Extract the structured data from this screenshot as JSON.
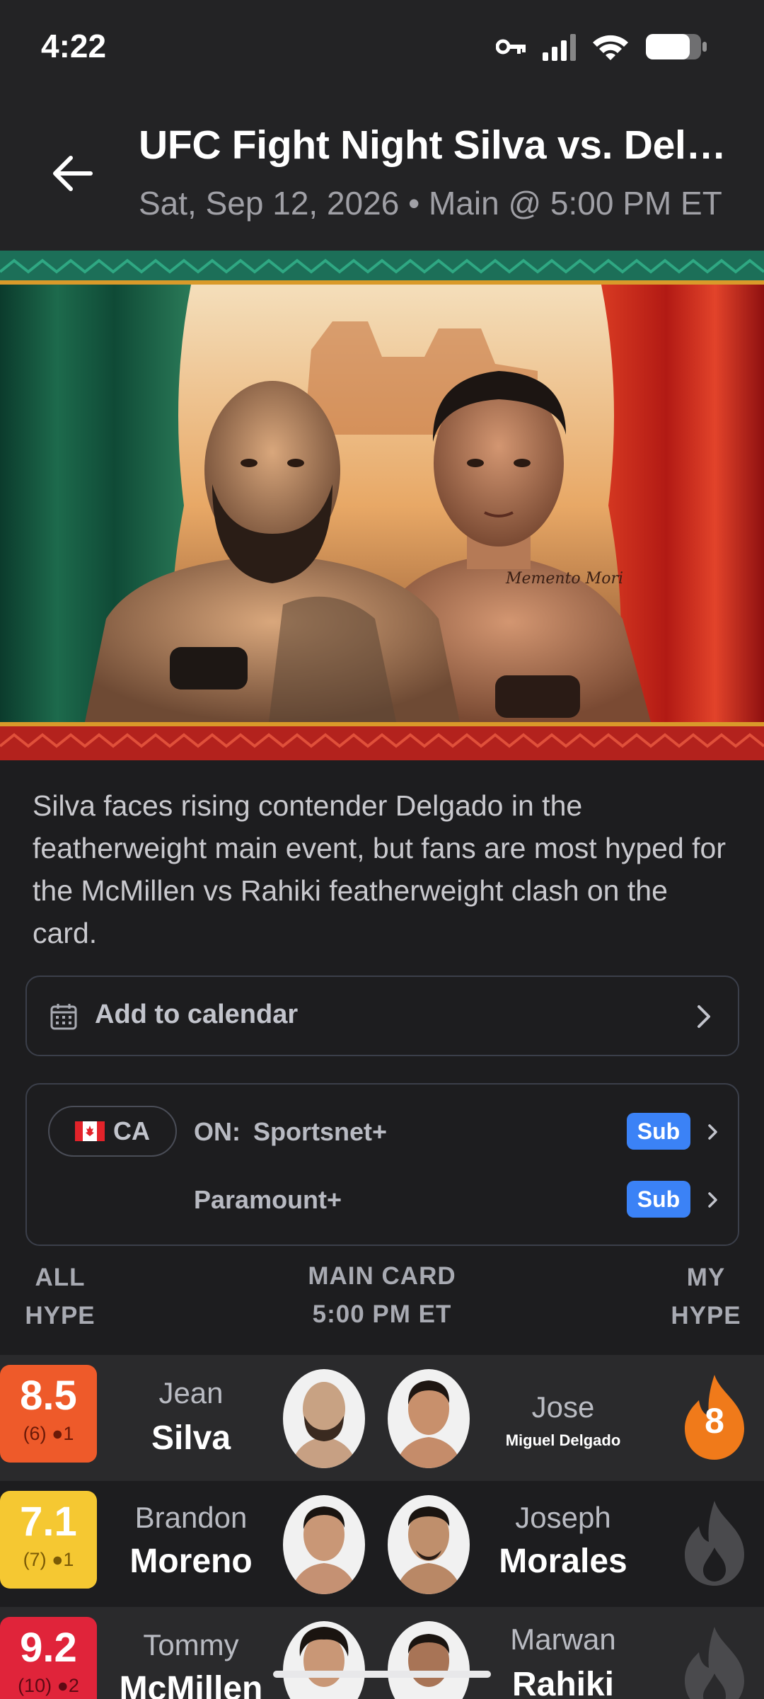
{
  "status_bar": {
    "time": "4:22"
  },
  "header": {
    "title": "UFC Fight Night Silva vs. Delgado",
    "subtitle": "Sat, Sep 12, 2026 • Main @ 5:00 PM ET"
  },
  "description": "Silva faces rising contender Delgado in the featherweight main event, but fans are most hyped for the McMillen vs Rahiki featherweight clash on the card.",
  "calendar": {
    "label": "Add to calendar"
  },
  "streaming": {
    "region": "CA",
    "on_label": "ON:",
    "providers": [
      {
        "name": "Sportsnet+",
        "badge": "Sub"
      },
      {
        "name": "Paramount+",
        "badge": "Sub"
      }
    ]
  },
  "section": {
    "all_hype": "ALL HYPE",
    "card_name": "MAIN CARD",
    "card_time": "5:00 PM ET",
    "my_hype": "MY HYPE"
  },
  "fights": [
    {
      "score": "8.5",
      "votes": "(6)",
      "comments": "1",
      "score_color": "#ee5a2a",
      "meta_color": "#6b1a08",
      "f1_first": "Jean",
      "f1_last": "Silva",
      "f2_first": "Jose",
      "f2_last": "Miguel Delgado",
      "my_hype": "8",
      "hype_active": true
    },
    {
      "score": "7.1",
      "votes": "(7)",
      "comments": "1",
      "score_color": "#f5c832",
      "meta_color": "#7a5a06",
      "f1_first": "Brandon",
      "f1_last": "Moreno",
      "f2_first": "Joseph",
      "f2_last": "Morales",
      "my_hype": "",
      "hype_active": false
    },
    {
      "score": "9.2",
      "votes": "(10)",
      "comments": "2",
      "score_color": "#e0243a",
      "meta_color": "#5e0a14",
      "f1_first": "Tommy",
      "f1_last": "McMillen",
      "f2_first": "Marwan",
      "f2_last": "Rahiki",
      "my_hype": "",
      "hype_active": false
    }
  ],
  "colors": {
    "background": "#1d1d1f",
    "header": "#232325",
    "accent_blue": "#3b82f6",
    "hype_orange": "#f07a1a"
  }
}
